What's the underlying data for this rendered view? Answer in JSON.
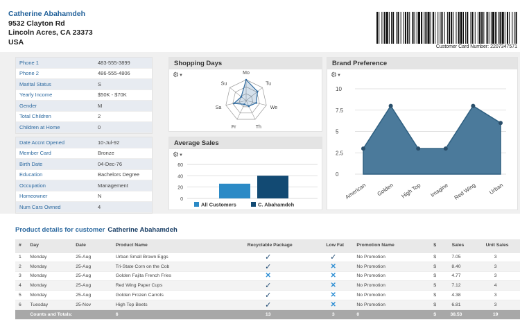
{
  "customer": {
    "name": "Catherine Abahamdeh",
    "street": "9532 Clayton Rd",
    "city": "Lincoln Acres, CA 23373",
    "country": "USA",
    "card_number_text": "Customer Card Number: 2207347571"
  },
  "profile": [
    {
      "label": "Phone 1",
      "value": "483-555-3899"
    },
    {
      "label": "Phone 2",
      "value": "486-555-4806"
    },
    {
      "label": "Marital Status",
      "value": "S"
    },
    {
      "label": "Yearly Income",
      "value": "$50K - $70K"
    },
    {
      "label": "Gender",
      "value": "M"
    },
    {
      "label": "Total Children",
      "value": "2"
    },
    {
      "label": "Children at Home",
      "value": "0"
    }
  ],
  "account": [
    {
      "label": "Date Accnt Opened",
      "value": "10-Jul-92"
    },
    {
      "label": "Member Card",
      "value": "Bronze"
    },
    {
      "label": "Birth Date",
      "value": "04-Dec-76"
    },
    {
      "label": "Education",
      "value": "Bachelors Degree"
    },
    {
      "label": "Occupation",
      "value": "Management"
    },
    {
      "label": "Homeowner",
      "value": "N"
    },
    {
      "label": "Num Cars Owned",
      "value": "4"
    }
  ],
  "panels": {
    "shopping_days": "Shopping Days",
    "average_sales": "Average Sales",
    "brand_preference": "Brand Preference"
  },
  "colors": {
    "accent": "#2d6aa0",
    "all_customers": "#2b8ac6",
    "customer": "#124a73",
    "area_fill": "#4b7a9b",
    "area_stroke": "#2e5f80"
  },
  "chart_data": [
    {
      "type": "radar",
      "title": "Shopping Days",
      "categories": [
        "Mo",
        "Tu",
        "We",
        "Th",
        "Fr",
        "Sa",
        "Su"
      ],
      "values": [
        1.0,
        0.7,
        0.5,
        0.3,
        0.2,
        0.6,
        0.3
      ]
    },
    {
      "type": "bar",
      "title": "Average Sales",
      "categories": [
        ""
      ],
      "series": [
        {
          "name": "All Customers",
          "values": [
            26
          ]
        },
        {
          "name": "C. Abahamdeh",
          "values": [
            40
          ]
        }
      ],
      "yticks": [
        "0",
        "20",
        "40",
        "60"
      ],
      "ylim": [
        0,
        60
      ],
      "legend": "bottom"
    },
    {
      "type": "area",
      "title": "Brand Preference",
      "categories": [
        "American",
        "Golden",
        "High Top",
        "Imagine",
        "Red Wing",
        "Urban"
      ],
      "values": [
        3,
        8,
        3,
        3,
        8,
        6
      ],
      "yticks": [
        "0",
        "2.5",
        "5",
        "7.5",
        "10"
      ],
      "ylim": [
        0,
        10
      ]
    }
  ],
  "products": {
    "title": "Product details for customer",
    "customer": "Catherine Abahamdeh",
    "columns": [
      "#",
      "Day",
      "Date",
      "Product Name",
      "Recyclable Package",
      "Low Fat",
      "Promotion Name",
      "$",
      "Sales",
      "Unit Sales"
    ],
    "rows": [
      [
        "1",
        "Monday",
        "25-Aug",
        "Urban Small Brown Eggs",
        "check",
        "check",
        "No Promotion",
        "$",
        "7.05",
        "3"
      ],
      [
        "2",
        "Monday",
        "25-Aug",
        "Tri-State Corn on the Cob",
        "check",
        "x",
        "No Promotion",
        "$",
        "8.40",
        "3"
      ],
      [
        "3",
        "Monday",
        "25-Aug",
        "Golden Fajita French Fries",
        "x",
        "x",
        "No Promotion",
        "$",
        "4.77",
        "3"
      ],
      [
        "4",
        "Monday",
        "25-Aug",
        "Red Wing Paper Cups",
        "check",
        "x",
        "No Promotion",
        "$",
        "7.12",
        "4"
      ],
      [
        "5",
        "Monday",
        "25-Aug",
        "Golden Frozen Carrots",
        "check",
        "x",
        "No Promotion",
        "$",
        "4.38",
        "3"
      ],
      [
        "6",
        "Tuesday",
        "25-Nov",
        "High Top Beets",
        "check",
        "x",
        "No Promotion",
        "$",
        "6.81",
        "3"
      ]
    ],
    "totals": {
      "label": "Counts and Totals:",
      "count": "6",
      "recyclable": "13",
      "low_fat": "3",
      "promotion": "0",
      "currency": "$",
      "sales": "38.53",
      "units": "19"
    }
  }
}
